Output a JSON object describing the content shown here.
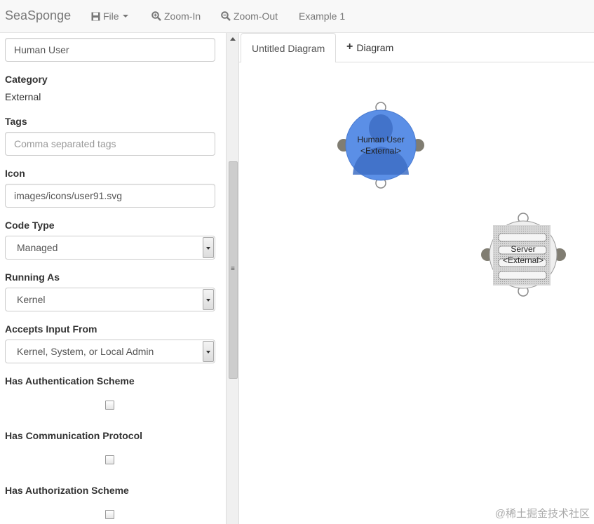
{
  "app": {
    "title": "SeaSponge"
  },
  "menu": {
    "file": "File",
    "zoom_in": "Zoom-In",
    "zoom_out": "Zoom-Out",
    "example": "Example 1"
  },
  "props": {
    "name_value": "Human User",
    "category_label": "Category",
    "category_value": "External",
    "tags_label": "Tags",
    "tags_placeholder": "Comma separated tags",
    "icon_label": "Icon",
    "icon_value": "images/icons/user91.svg",
    "code_type_label": "Code Type",
    "code_type_value": "Managed",
    "running_as_label": "Running As",
    "running_as_value": "Kernel",
    "accepts_input_label": "Accepts Input From",
    "accepts_input_value": "Kernel, System, or Local Admin",
    "has_auth_label": "Has Authentication Scheme",
    "has_auth_checked": false,
    "has_comm_label": "Has Communication Protocol",
    "has_comm_checked": false,
    "has_authz_label": "Has Authorization Scheme",
    "has_authz_checked": false
  },
  "tabs": {
    "active": "Untitled Diagram",
    "add": "Diagram"
  },
  "diagram": {
    "nodes": [
      {
        "name": "Human User",
        "type": "<External>",
        "fill": "#5b8fe6",
        "selected": true
      },
      {
        "name": "Server",
        "type": "<External>",
        "fill": "#d8d8d8",
        "selected": false
      }
    ]
  },
  "watermark": "@稀土掘金技术社区"
}
